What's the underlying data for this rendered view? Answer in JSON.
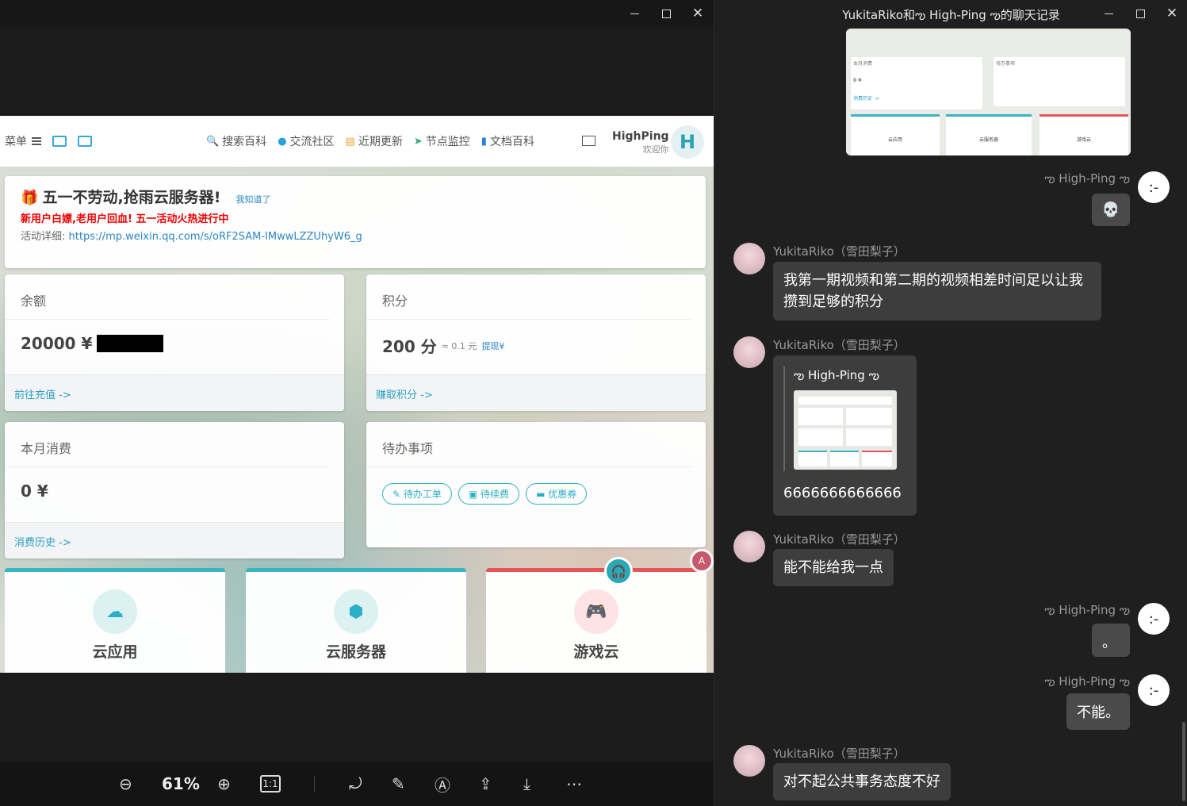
{
  "viewer": {
    "zoom": "61%",
    "toolbar": {
      "zoom_out_icon": "zoom-out-icon",
      "zoom_in_icon": "zoom-in-icon",
      "actual_size_label": "1:1"
    },
    "screenshot": {
      "nav": {
        "menu_label": "菜单",
        "links": [
          "搜索百科",
          "交流社区",
          "近期更新",
          "节点监控",
          "文档百科"
        ],
        "user_name": "HighPing",
        "welcome": "欢迎你",
        "avatar_letter": "H"
      },
      "notice": {
        "title": "五一不劳动,抢雨云服务器!",
        "dismiss": "我知道了",
        "promo": "新用户白嫖,老用户回血! 五一活动火热进行中",
        "detail_label": "活动详细:",
        "detail_link": "https://mp.weixin.qq.com/s/oRF2SAM-IMwwLZZUhyW6_g"
      },
      "balance": {
        "title": "余额",
        "value": "20000 ¥",
        "link": "前往充值 ->"
      },
      "points": {
        "title": "积分",
        "value": "200 分",
        "approx": "≈ 0.1 元",
        "withdraw": "提现¥",
        "link": "赚取积分 ->"
      },
      "monthly": {
        "title": "本月消费",
        "value": "0 ¥",
        "link": "消费历史 ->"
      },
      "todo": {
        "title": "待办事项",
        "buttons": [
          "待办工单",
          "待续费",
          "优惠券"
        ]
      },
      "services": [
        "云应用",
        "云服务器",
        "游戏云"
      ]
    }
  },
  "chat": {
    "title": "YukitaRiko和ఌ High-Ping ఌ的聊天记录",
    "messages": [
      {
        "side": "right",
        "name": "ఌ High-Ping ఌ",
        "text": "💀"
      },
      {
        "side": "left",
        "name": "YukitaRiko（雪田梨子）",
        "text": "我第一期视频和第二期的视频相差时间足以让我攒到足够的积分"
      },
      {
        "side": "left",
        "name": "YukitaRiko（雪田梨子）",
        "quote_name": "ఌ High-Ping ఌ",
        "text": "6666666666666"
      },
      {
        "side": "left",
        "name": "YukitaRiko（雪田梨子）",
        "text": "能不能给我一点"
      },
      {
        "side": "right",
        "name": "ఌ High-Ping ఌ",
        "text": "。"
      },
      {
        "side": "right",
        "name": "ఌ High-Ping ఌ",
        "text": "不能。"
      },
      {
        "side": "left",
        "name": "YukitaRiko（雪田梨子）",
        "text": "对不起公共事务态度不好"
      }
    ],
    "preview": {
      "monthly_title": "本月消费",
      "monthly_value": "0 ¥",
      "monthly_link": "消费历史 ->",
      "todo_title": "待办事项",
      "services": [
        "云应用",
        "云服务器",
        "游戏云"
      ]
    }
  }
}
